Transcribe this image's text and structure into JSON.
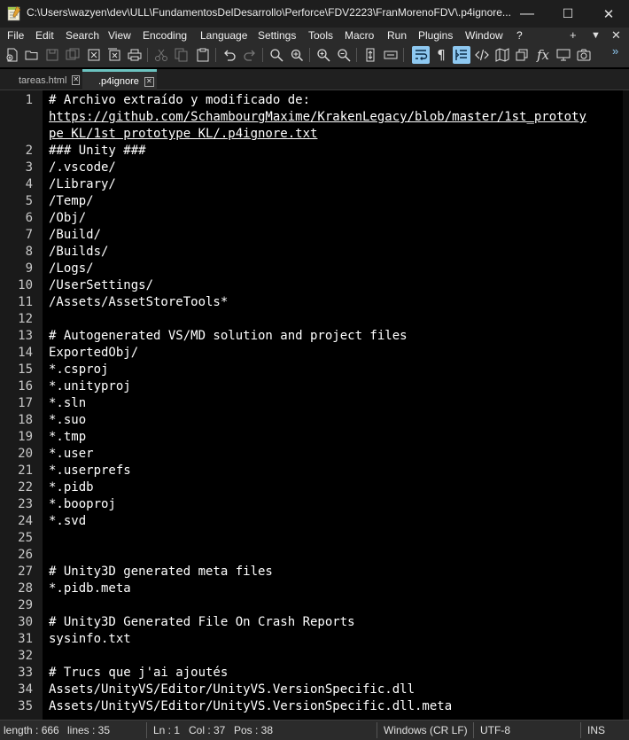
{
  "window": {
    "title": "C:\\Users\\wazyen\\dev\\ULL\\FundamentosDelDesarrollo\\Perforce\\FDV2223\\FranMorenoFDV\\.p4ignore...",
    "minimize": "—",
    "maximize": "☐",
    "close": "✕"
  },
  "menu": {
    "items": [
      "File",
      "Edit",
      "Search",
      "View",
      "Encoding",
      "Language",
      "Settings",
      "Tools",
      "Macro",
      "Run",
      "Plugins",
      "Window",
      "?"
    ],
    "right": [
      "+",
      "▼",
      "✕"
    ]
  },
  "toolbar": {
    "icons": [
      "new-file-icon",
      "open-file-icon",
      "save-icon",
      "save-all-icon",
      "close-icon",
      "close-all-icon",
      "print-icon",
      "cut-icon",
      "copy-icon",
      "paste-icon",
      "undo-icon",
      "redo-icon",
      "find-icon",
      "replace-icon",
      "zoom-in-icon",
      "zoom-out-icon",
      "sync-vertical-icon",
      "sync-horizontal-icon",
      "word-wrap-icon",
      "show-all-chars-icon",
      "indent-guide-icon",
      "xml-icon",
      "map-icon",
      "function-list-icon",
      "fx-icon",
      "monitor-icon",
      "record-macro-icon"
    ],
    "overflow": "»"
  },
  "tabs": [
    {
      "label": "tareas.html",
      "active": false
    },
    {
      "label": ".p4ignore",
      "active": true
    }
  ],
  "lines": [
    {
      "n": "1",
      "text": "# Archivo extraído y modificado de:"
    },
    {
      "n": "",
      "text": "https://github.com/SchambourgMaxime/KrakenLegacy/blob/master/1st_prototy",
      "url": true
    },
    {
      "n": "",
      "text": "pe KL/1st prototype KL/.p4ignore.txt",
      "url": true
    },
    {
      "n": "2",
      "text": "### Unity ###"
    },
    {
      "n": "3",
      "text": "/.vscode/"
    },
    {
      "n": "4",
      "text": "/Library/"
    },
    {
      "n": "5",
      "text": "/Temp/"
    },
    {
      "n": "6",
      "text": "/Obj/"
    },
    {
      "n": "7",
      "text": "/Build/"
    },
    {
      "n": "8",
      "text": "/Builds/"
    },
    {
      "n": "9",
      "text": "/Logs/"
    },
    {
      "n": "10",
      "text": "/UserSettings/"
    },
    {
      "n": "11",
      "text": "/Assets/AssetStoreTools*"
    },
    {
      "n": "12",
      "text": ""
    },
    {
      "n": "13",
      "text": "# Autogenerated VS/MD solution and project files"
    },
    {
      "n": "14",
      "text": "ExportedObj/"
    },
    {
      "n": "15",
      "text": "*.csproj"
    },
    {
      "n": "16",
      "text": "*.unityproj"
    },
    {
      "n": "17",
      "text": "*.sln"
    },
    {
      "n": "18",
      "text": "*.suo"
    },
    {
      "n": "19",
      "text": "*.tmp"
    },
    {
      "n": "20",
      "text": "*.user"
    },
    {
      "n": "21",
      "text": "*.userprefs"
    },
    {
      "n": "22",
      "text": "*.pidb"
    },
    {
      "n": "23",
      "text": "*.booproj"
    },
    {
      "n": "24",
      "text": "*.svd"
    },
    {
      "n": "25",
      "text": ""
    },
    {
      "n": "26",
      "text": ""
    },
    {
      "n": "27",
      "text": "# Unity3D generated meta files"
    },
    {
      "n": "28",
      "text": "*.pidb.meta"
    },
    {
      "n": "29",
      "text": ""
    },
    {
      "n": "30",
      "text": "# Unity3D Generated File On Crash Reports"
    },
    {
      "n": "31",
      "text": "sysinfo.txt"
    },
    {
      "n": "32",
      "text": ""
    },
    {
      "n": "33",
      "text": "# Trucs que j'ai ajoutés"
    },
    {
      "n": "34",
      "text": "Assets/UnityVS/Editor/UnityVS.VersionSpecific.dll"
    },
    {
      "n": "35",
      "text": "Assets/UnityVS/Editor/UnityVS.VersionSpecific.dll.meta"
    }
  ],
  "status": {
    "length": "length : 666",
    "lines": "lines : 35",
    "ln": "Ln : 1",
    "col": "Col : 37",
    "pos": "Pos : 38",
    "eol": "Windows (CR LF)",
    "encoding": "UTF-8",
    "mode": "INS"
  },
  "colors": {
    "active_tab_accent": "#6cc3c0",
    "toggle_on": "#8ec8f0"
  }
}
